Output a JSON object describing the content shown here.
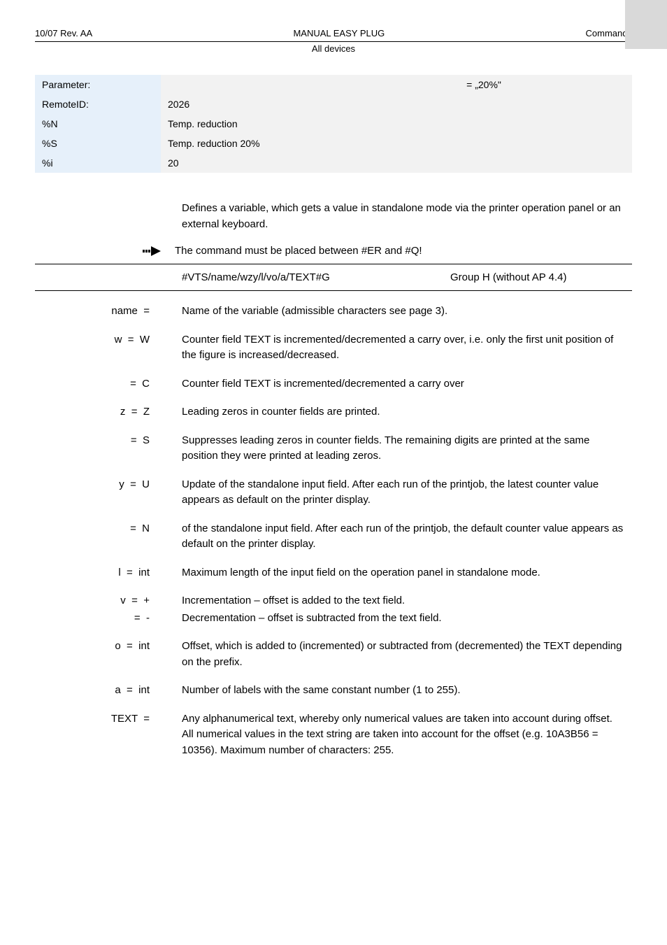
{
  "header": {
    "left": "10/07 Rev. AA",
    "center": "MANUAL EASY PLUG",
    "right": "Commands",
    "sub": "All devices"
  },
  "param_table": {
    "rows": [
      {
        "label": "Parameter:",
        "value": "= „20%\""
      },
      {
        "label": "RemoteID:",
        "value": "2026"
      },
      {
        "label": "%N",
        "value": "Temp. reduction"
      },
      {
        "label": "%S",
        "value": "Temp. reduction 20%"
      },
      {
        "label": "%i",
        "value": "20"
      }
    ]
  },
  "intro": "Defines a variable, which gets a value in standalone mode via the printer operation panel or an external keyboard.",
  "arrow_note": "The command must be placed between #ER and #Q!",
  "command": {
    "syntax": "#VTS/name/wzy/l/vo/a/TEXT#G",
    "group": "Group H (without AP 4.4)"
  },
  "defs": [
    {
      "k": "name  =",
      "v": "Name of the variable (admissible characters see page 3)."
    },
    {
      "k": "w  =  W",
      "v": "Counter field TEXT is incremented/decremented         a carry over, i.e. only the first unit position of the figure is increased/decreased."
    },
    {
      "k": "=  C",
      "v": "Counter field TEXT is incremented/decremented         a carry over"
    },
    {
      "k": "z  =  Z",
      "v": "Leading zeros in counter fields are printed."
    },
    {
      "k": "=  S",
      "v": "Suppresses leading zeros in counter fields. The remaining digits are printed at the same position they were printed at         leading zeros."
    },
    {
      "k": "y  =  U",
      "v": "Update of the standalone input field. After each run of the printjob, the latest counter value appears as default on the printer display."
    },
    {
      "k": "=  N",
      "v": "         of the standalone input field. After each run of the printjob, the default counter value appears as default on the printer display."
    },
    {
      "k": "l  =  int",
      "v": "Maximum length of the input field on the operation panel in standalone mode."
    },
    {
      "k": "v  =  +",
      "v": "Incrementation – offset is added to the text field."
    },
    {
      "k": "=  -",
      "v": "Decrementation – offset is subtracted from the text field."
    },
    {
      "k": "o  =  int",
      "v": "Offset, which is added to (incremented) or subtracted from (decremented) the TEXT depending on the prefix."
    },
    {
      "k": "a  =  int",
      "v": "Number of labels with the same constant number (1 to 255)."
    },
    {
      "k": "TEXT  =",
      "v": "Any alphanumerical text, whereby only numerical values are taken into account during offset. All numerical values in the text string are taken into account for the offset (e.g. 10A3B56 = 10356). Maximum number of characters: 255."
    }
  ]
}
